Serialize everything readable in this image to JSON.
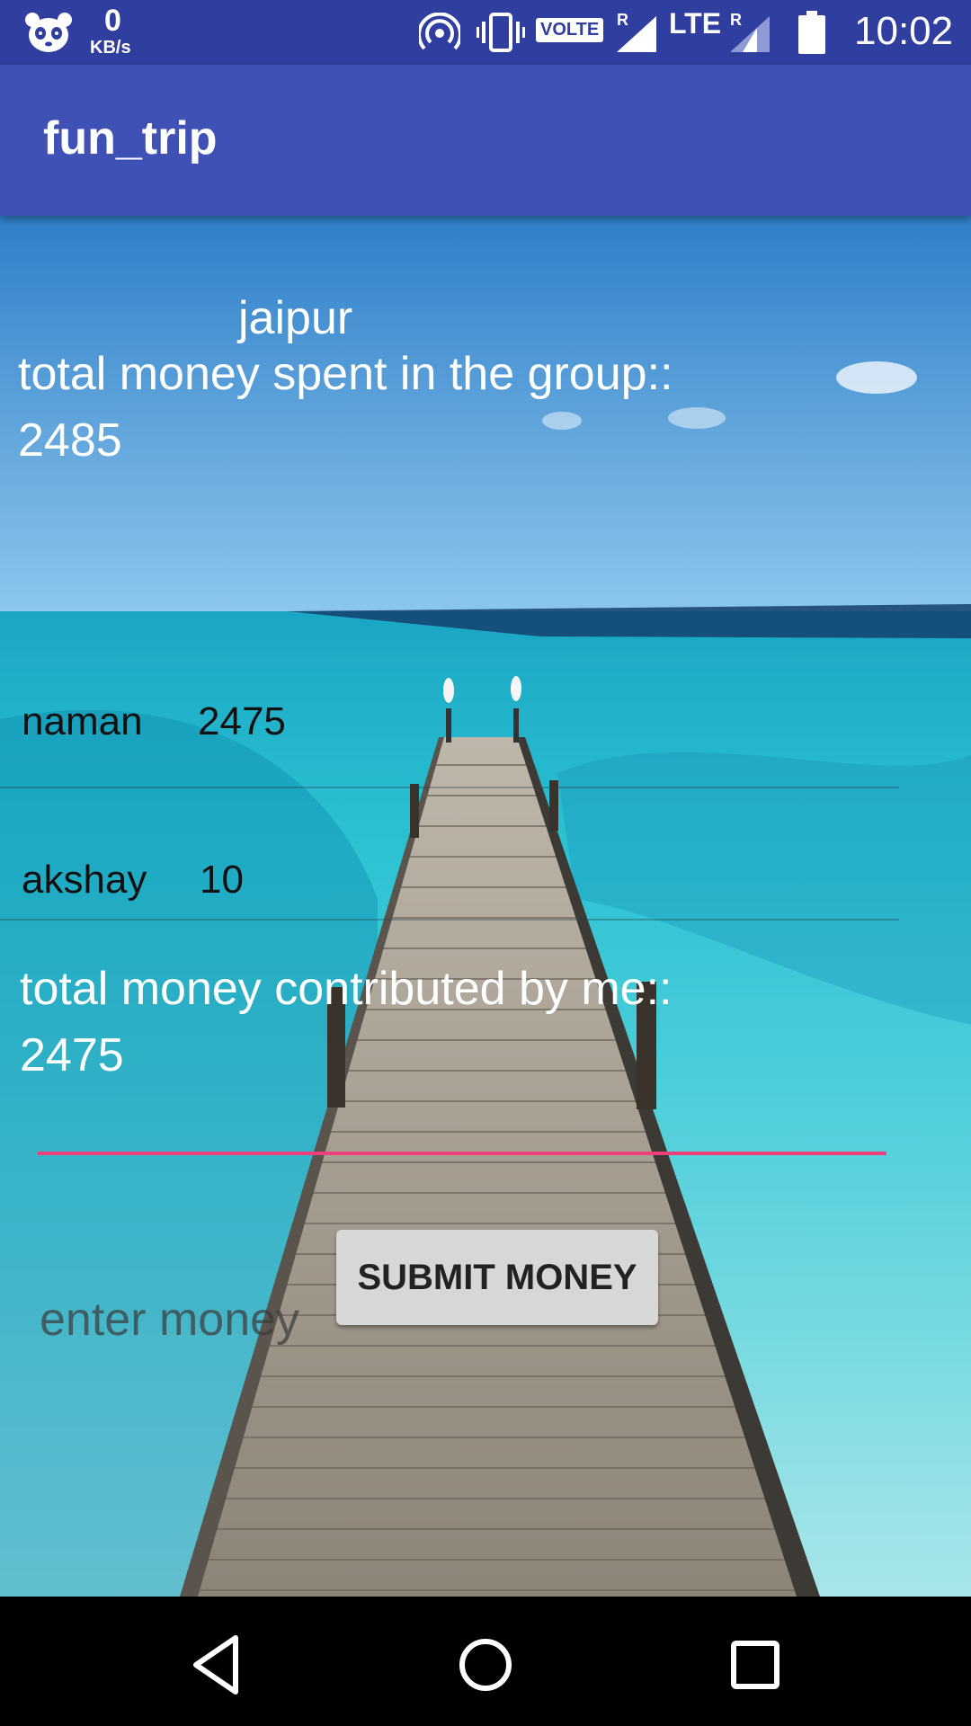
{
  "status_bar": {
    "speed_value": "0",
    "speed_unit": "KB/s",
    "volte": "VOLTE",
    "lte": "LTE",
    "roaming_1": "R",
    "roaming_2": "R",
    "time": "10:02"
  },
  "app_bar": {
    "title": "fun_trip"
  },
  "trip": {
    "name": "jaipur",
    "total_spent_label": "total money spent in the group::",
    "total_spent_value": "2485",
    "members": [
      {
        "name": "naman",
        "amount": "2475"
      },
      {
        "name": "akshay",
        "amount": "10"
      }
    ],
    "contributed_label": "total money contributed by me::",
    "contributed_value": "2475"
  },
  "form": {
    "money_placeholder": "enter money",
    "submit_label": "SUBMIT MONEY"
  },
  "colors": {
    "status_bar": "#303F9F",
    "app_bar": "#3F51B5",
    "input_accent": "#EC407A",
    "button_bg": "#D6D7D7"
  },
  "icons": [
    "panda-icon",
    "hotspot-icon",
    "vibrate-icon",
    "signal-icon",
    "battery-icon",
    "back-icon",
    "home-icon",
    "recents-icon"
  ]
}
